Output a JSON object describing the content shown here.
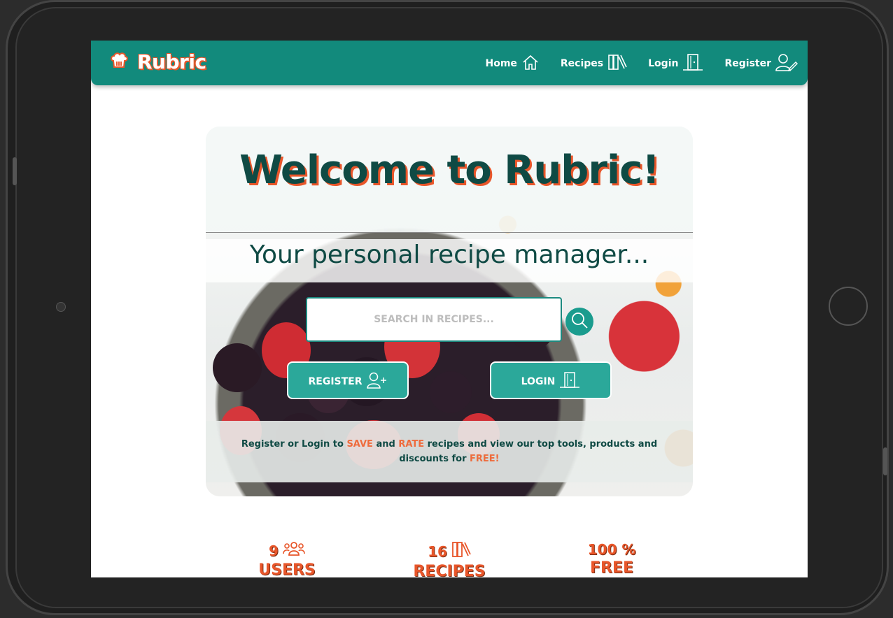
{
  "app": {
    "brand": "Rubric"
  },
  "nav": {
    "home": "Home",
    "recipes": "Recipes",
    "login": "Login",
    "register": "Register"
  },
  "hero": {
    "title": "Welcome to Rubric!",
    "subtitle": "Your personal recipe manager...",
    "search_placeholder": "SEARCH IN RECIPES...",
    "register_button": "REGISTER",
    "login_button": "LOGIN",
    "info": {
      "part1": "Register or Login to ",
      "save": "SAVE",
      "part2": " and ",
      "rate": "RATE",
      "part3": " recipes and view our top tools, products and discounts for ",
      "free": "FREE!"
    }
  },
  "stats": [
    {
      "value": "9",
      "label": "USERS",
      "icon": "users-icon"
    },
    {
      "value": "16",
      "label": "RECIPES",
      "icon": "books-icon"
    },
    {
      "value": "100 %",
      "label": "FREE",
      "icon": ""
    }
  ],
  "colors": {
    "primary": "#128a7c",
    "accent": "#e8562a",
    "dark": "#0f4a44"
  }
}
